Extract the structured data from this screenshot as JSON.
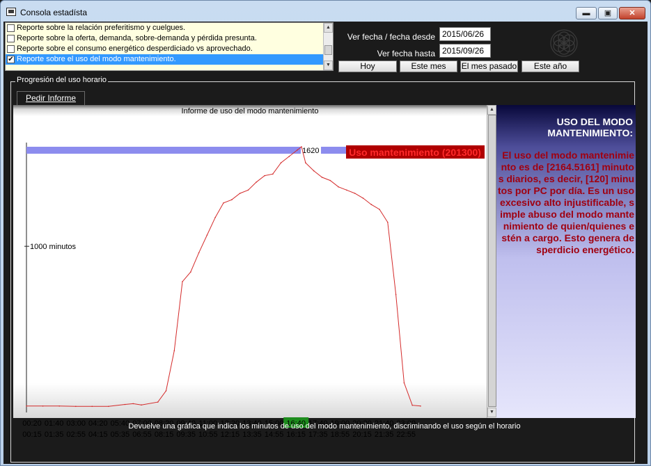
{
  "window": {
    "title": "Consola estadísta",
    "min_glyph": "▬",
    "max_glyph": "▣",
    "close_glyph": "✕"
  },
  "reports": [
    {
      "label": "Reporte sobre la relación preferitismo y cuelgues.",
      "checked": false,
      "selected": false
    },
    {
      "label": "Reporte sobre la oferta, demanda, sobre-demanda y pérdida presunta.",
      "checked": false,
      "selected": false
    },
    {
      "label": "Reporte sobre el consumo energético desperdiciado vs aprovechado.",
      "checked": false,
      "selected": false
    },
    {
      "label": "Reporte sobre el uso del modo mantenimiento.",
      "checked": true,
      "selected": true
    }
  ],
  "dates": {
    "from_label": "Ver fecha / fecha desde",
    "from_value": "2015/06/26",
    "to_label": "Ver fecha hasta",
    "to_value": "2015/09/26"
  },
  "presets": [
    "Hoy",
    "Este mes",
    "El mes pasado",
    "Este año"
  ],
  "group_title": "Progresión del uso horario",
  "tab_label": "Pedir Informe",
  "chart_data": {
    "type": "line",
    "title": "Informe de uso del modo mantenimiento",
    "ytick_label": "1000 minutos",
    "ylim": [
      0,
      1620
    ],
    "peak_label": "1620",
    "legend_badge": "Uso mantenimiento (201300)",
    "colors": {
      "line": "#d42a2a",
      "bar": "#8c8cee",
      "badge": "#b00000",
      "highlight": "#1d8c1d"
    },
    "x_row1": [
      "00:20",
      "01:40",
      "03:00",
      "04:20",
      "05:40",
      "07:00",
      "08:20",
      "09:40",
      "11:00",
      "12:20",
      "13:40",
      "15:00",
      "16:40",
      "17:40",
      "19:00",
      "20:20",
      "21:40",
      "23:00"
    ],
    "x_row2": [
      "00:15",
      "01:35",
      "02:55",
      "04:15",
      "05:35",
      "06:55",
      "08:15",
      "09:35",
      "10:55",
      "12:15",
      "13:35",
      "14:55",
      "16:15",
      "17:35",
      "18:55",
      "20:15",
      "21:35",
      "22:55"
    ],
    "highlight_label": "16:40",
    "x": [
      "00:00",
      "01:00",
      "02:00",
      "03:00",
      "04:00",
      "05:00",
      "06:00",
      "06:30",
      "07:00",
      "08:00",
      "08:30",
      "09:00",
      "09:30",
      "10:00",
      "10:30",
      "11:00",
      "11:30",
      "12:00",
      "12:30",
      "13:00",
      "13:30",
      "14:00",
      "14:30",
      "15:00",
      "15:30",
      "16:00",
      "16:30",
      "16:45",
      "17:00",
      "17:30",
      "18:00",
      "18:30",
      "19:00",
      "19:30",
      "20:00",
      "20:30",
      "21:00",
      "21:30",
      "22:00",
      "22:30",
      "23:00",
      "23:30",
      "24:00"
    ],
    "values": [
      5,
      5,
      5,
      3,
      3,
      3,
      15,
      20,
      12,
      30,
      100,
      350,
      780,
      840,
      960,
      1070,
      1180,
      1270,
      1290,
      1330,
      1350,
      1400,
      1440,
      1450,
      1520,
      1560,
      1600,
      1620,
      1520,
      1470,
      1430,
      1410,
      1370,
      1350,
      1330,
      1300,
      1260,
      1230,
      1150,
      700,
      150,
      10,
      5
    ]
  },
  "side": {
    "heading": "USO DEL MODO MANTENIMIENTO:",
    "body": "El uso del modo mantenimiento es de [2164.5161] minutos diarios, es decir, [120] minutos por PC por día. Es un uso excesivo alto injustificable, simple abuso del modo mantenimiento de quien/quienes estén a cargo. Esto genera desperdicio energético."
  },
  "footer": "Devuelve una gráfica que indica los minutos de uso del modo mantenimiento, discriminando el uso según el horario"
}
